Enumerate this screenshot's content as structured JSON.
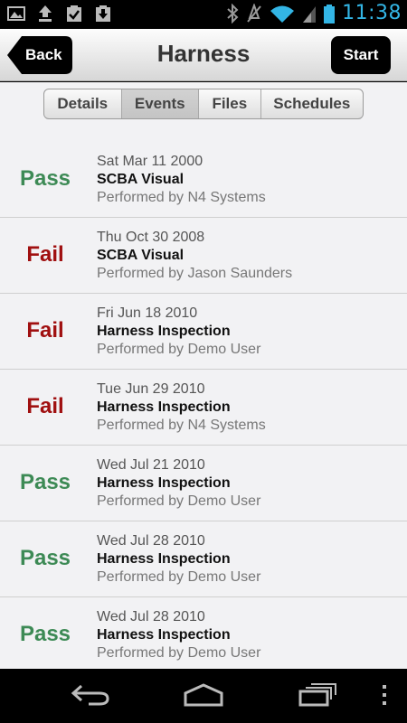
{
  "status_bar": {
    "time": "11:38",
    "icons": [
      "image-icon",
      "upload-icon",
      "clipboard-check-icon",
      "download-icon",
      "bluetooth-icon",
      "mute-icon",
      "wifi-icon",
      "signal-icon",
      "battery-icon"
    ]
  },
  "header": {
    "back_label": "Back",
    "title": "Harness",
    "start_label": "Start"
  },
  "tabs": [
    {
      "label": "Details",
      "selected": false
    },
    {
      "label": "Events",
      "selected": true
    },
    {
      "label": "Files",
      "selected": false
    },
    {
      "label": "Schedules",
      "selected": false
    }
  ],
  "events": [
    {
      "result": "Pass",
      "date": "Sat Mar 11 2000",
      "name": "SCBA Visual",
      "performed_by": "Performed by N4 Systems"
    },
    {
      "result": "Fail",
      "date": "Thu Oct 30 2008",
      "name": "SCBA Visual",
      "performed_by": "Performed by Jason Saunders"
    },
    {
      "result": "Fail",
      "date": "Fri Jun 18 2010",
      "name": "Harness Inspection",
      "performed_by": "Performed by Demo User"
    },
    {
      "result": "Fail",
      "date": "Tue Jun 29 2010",
      "name": "Harness Inspection",
      "performed_by": "Performed by N4 Systems"
    },
    {
      "result": "Pass",
      "date": "Wed Jul 21 2010",
      "name": "Harness Inspection",
      "performed_by": "Performed by Demo User"
    },
    {
      "result": "Pass",
      "date": "Wed Jul 28 2010",
      "name": "Harness Inspection",
      "performed_by": "Performed by Demo User"
    },
    {
      "result": "Pass",
      "date": "Wed Jul 28 2010",
      "name": "Harness Inspection",
      "performed_by": "Performed by Demo User"
    }
  ],
  "colors": {
    "pass": "#3d8a55",
    "fail": "#a01010",
    "time": "#33b5e5"
  },
  "nav_bar": [
    "back-icon",
    "home-icon",
    "recent-apps-icon",
    "menu-icon"
  ]
}
